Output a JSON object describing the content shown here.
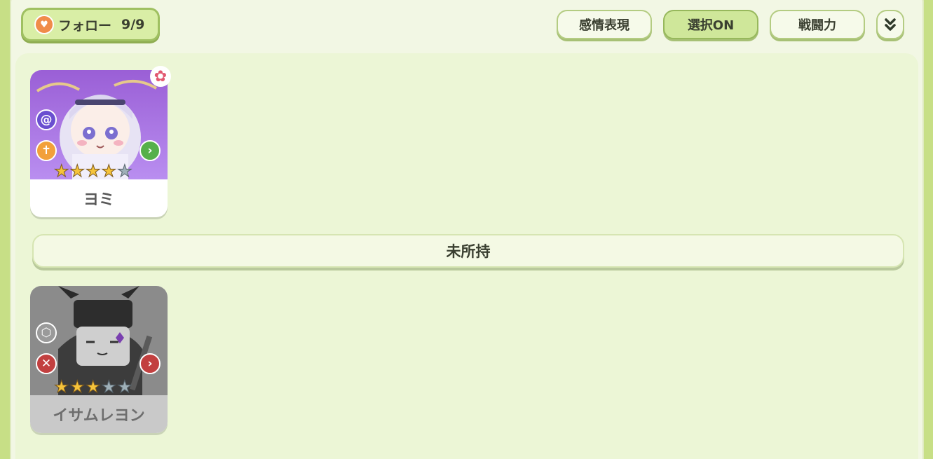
{
  "header": {
    "follow_label": "フォロー",
    "follow_count": "9/9",
    "buttons": [
      {
        "label": "感情表現",
        "active": false
      },
      {
        "label": "選択ON",
        "active": true
      },
      {
        "label": "戦闘力",
        "active": false
      }
    ],
    "expand_icon": "double-chevron-down-icon"
  },
  "owned": {
    "characters": [
      {
        "name": "ヨミ",
        "stars_on": 4,
        "stars_total": 5,
        "element_icon": "swirl-icon",
        "role_icon": "cross-icon",
        "arrow_icon": "chevron-right-icon",
        "corner_icon": "flower-icon",
        "accent_color": "#a66fe0"
      }
    ]
  },
  "unowned": {
    "section_label": "未所持",
    "characters": [
      {
        "name": "イサムレヨン",
        "stars_on": 3,
        "stars_total": 5,
        "element_icon": "hexagon-icon",
        "role_icon": "wrench-icon",
        "arrow_icon": "chevron-right-icon",
        "accent_color": "#6a6a6a"
      }
    ]
  }
}
